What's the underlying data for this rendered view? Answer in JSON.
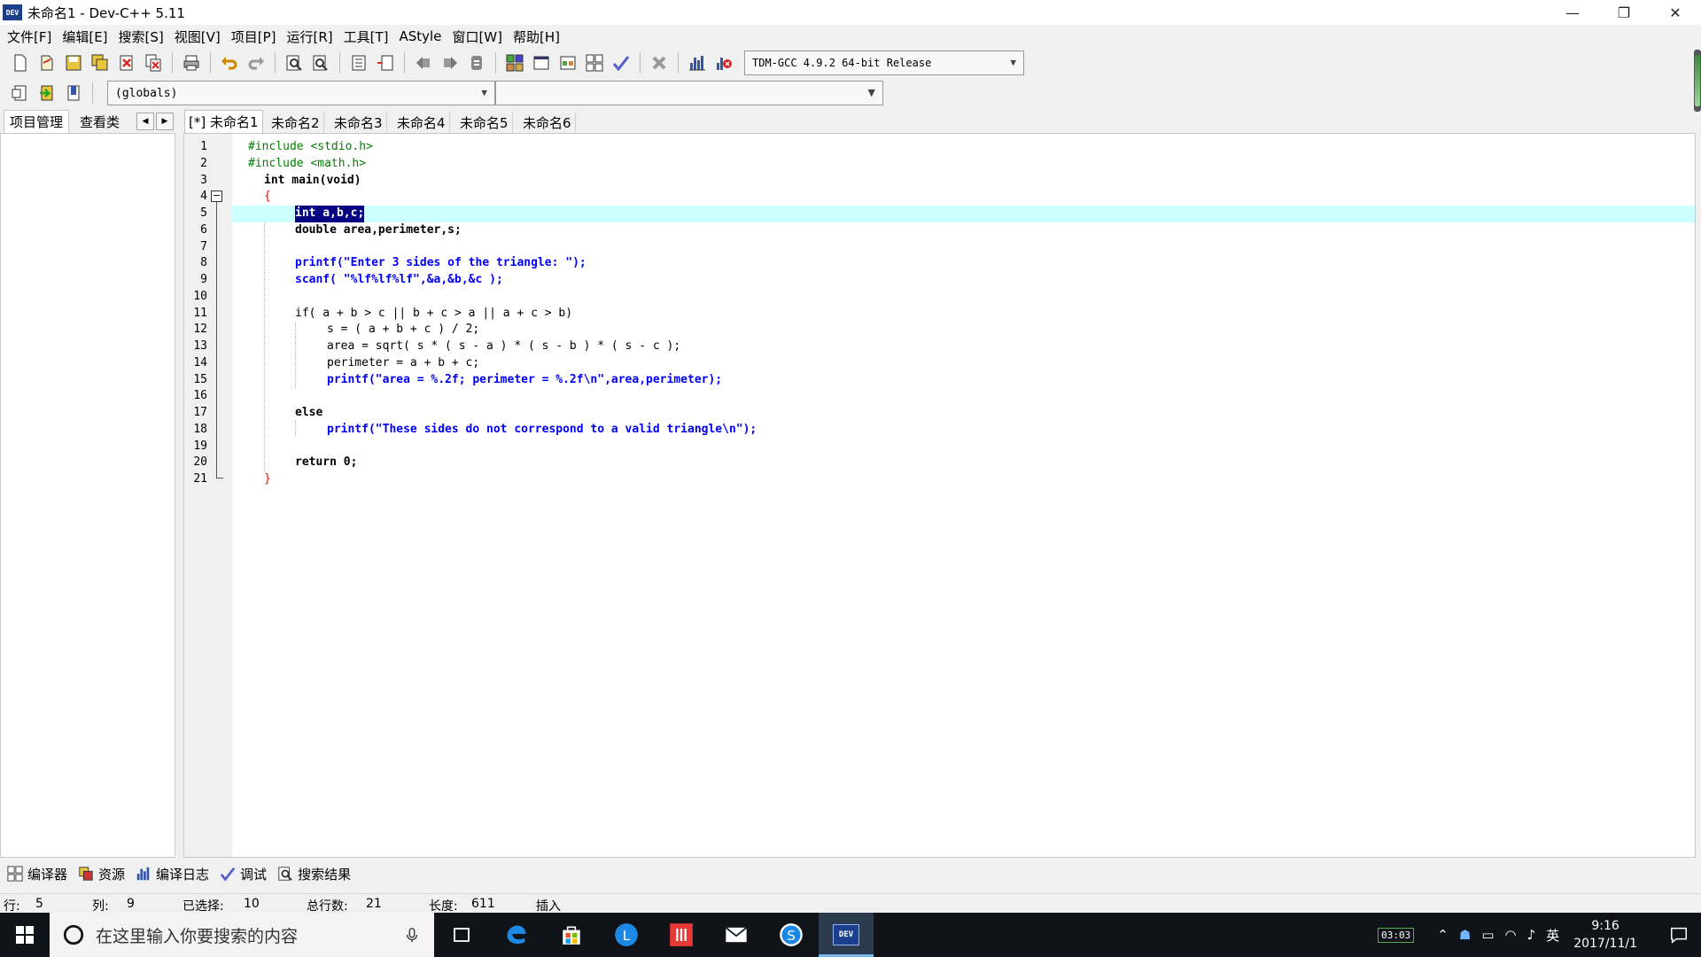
{
  "window": {
    "title": "未命名1 - Dev-C++ 5.11",
    "app_icon_text": "DEV"
  },
  "window_controls": {
    "minimize": "—",
    "restore": "❐",
    "close": "✕"
  },
  "menu": [
    "文件[F]",
    "编辑[E]",
    "搜索[S]",
    "视图[V]",
    "项目[P]",
    "运行[R]",
    "工具[T]",
    "AStyle",
    "窗口[W]",
    "帮助[H]"
  ],
  "toolbar": {
    "compiler": "TDM-GCC 4.9.2 64-bit Release",
    "scope": "(globals)"
  },
  "left_tabs": [
    "项目管理",
    "查看类"
  ],
  "nav_buttons": [
    "◀",
    "▶"
  ],
  "editor_tabs": [
    "[*] 未命名1",
    "未命名2",
    "未命名3",
    "未命名4",
    "未命名5",
    "未命名6"
  ],
  "code_lines": [
    "#include <stdio.h>",
    "#include <math.h>",
    "int main(void)",
    "{",
    "int a,b,c;",
    "double area,perimeter,s;",
    "",
    "printf(\"Enter 3 sides of the triangle: \");",
    "scanf( \"%lf%lf%lf\",&a,&b,&c );",
    "",
    "if( a + b > c || b + c > a || a + c > b)",
    "s = ( a + b + c ) / 2;",
    "area = sqrt( s * ( s - a ) * ( s - b ) * ( s - c );",
    "perimeter = a + b + c;",
    "printf(\"area = %.2f; perimeter = %.2f\\n\",area,perimeter);",
    "",
    "else",
    "printf(\"These sides do not correspond to a valid triangle\\n\");",
    "",
    "return 0;",
    "}"
  ],
  "line_numbers": [
    "1",
    "2",
    "3",
    "4",
    "5",
    "6",
    "7",
    "8",
    "9",
    "10",
    "11",
    "12",
    "13",
    "14",
    "15",
    "16",
    "17",
    "18",
    "19",
    "20",
    "21"
  ],
  "current_line": 5,
  "fold_toggle": "−",
  "bottom_tabs": [
    "编译器",
    "资源",
    "编译日志",
    "调试",
    "搜索结果"
  ],
  "status": {
    "row_label": "行:",
    "row": "5",
    "col_label": "列:",
    "col": "9",
    "sel_label": "已选择:",
    "sel": "10",
    "total_label": "总行数:",
    "total": "21",
    "len_label": "长度:",
    "len": "611",
    "mode": "插入"
  },
  "taskbar": {
    "search_placeholder": "在这里输入你要搜索的内容",
    "battery_time": "03:03",
    "ime": "英",
    "time": "9:16",
    "date": "2017/11/1",
    "dev_icon_text": "DEV"
  }
}
